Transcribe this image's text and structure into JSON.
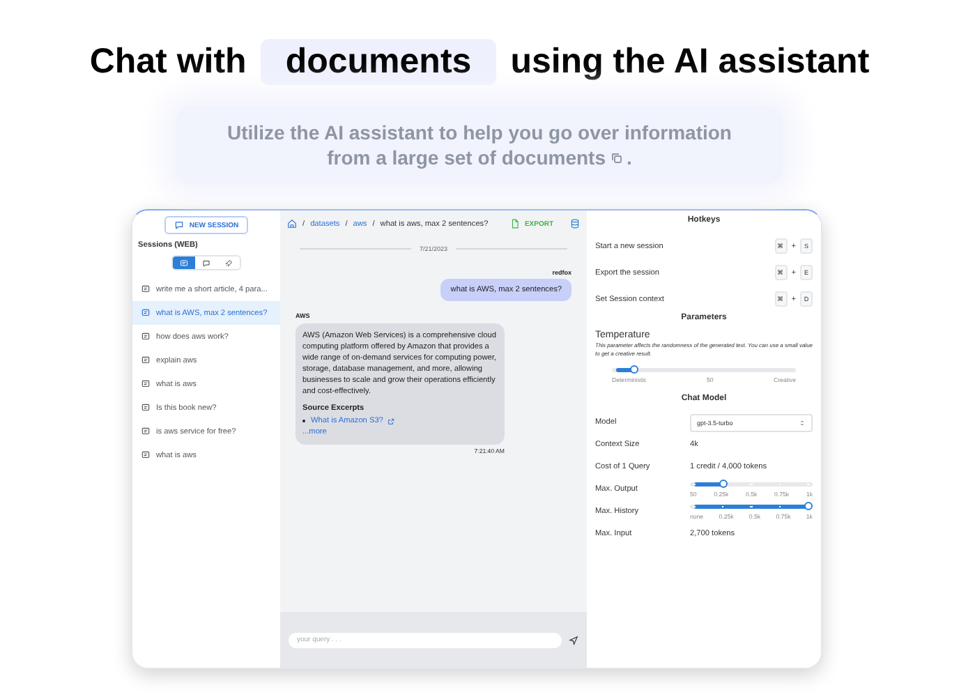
{
  "headline": {
    "before": "Chat with",
    "highlight": "documents",
    "after": "using the AI assistant"
  },
  "subtitle": {
    "lines": [
      "Utilize the AI assistant to help you go over information",
      "from a large set of documents"
    ],
    "end": "."
  },
  "sidebar": {
    "new_session": "NEW SESSION",
    "title": "Sessions (WEB)",
    "filters": [
      {
        "kind": "list",
        "selected": true
      },
      {
        "kind": "chat",
        "selected": false
      },
      {
        "kind": "rocket",
        "selected": false
      }
    ],
    "sessions": [
      {
        "label": "write me a short article, 4 para...",
        "selected": false
      },
      {
        "label": "what is AWS, max 2 sentences?",
        "selected": true
      },
      {
        "label": "how does aws work?",
        "selected": false
      },
      {
        "label": "explain aws",
        "selected": false
      },
      {
        "label": "what is aws",
        "selected": false
      },
      {
        "label": "Is this book new?",
        "selected": false
      },
      {
        "label": "is aws service for free?",
        "selected": false
      },
      {
        "label": "what is aws",
        "selected": false
      }
    ]
  },
  "chat": {
    "separator": "/",
    "breadcrumb": [
      "datasets",
      "aws"
    ],
    "current": "what is aws, max 2 sentences?",
    "export": "EXPORT",
    "date": "7/21/2023",
    "messages": [
      {
        "kind": "user",
        "author": "redfox",
        "text": "what is AWS, max 2 sentences?"
      },
      {
        "kind": "assistant",
        "author": "AWS",
        "text": "AWS (Amazon Web Services) is a comprehensive cloud computing platform offered by Amazon that provides a wide range of on-demand services for computing power, storage, database management, and more, allowing businesses to scale and grow their operations efficiently and cost-effectively.",
        "sources_title": "Source Excerpts",
        "sources": [
          "What is Amazon S3?"
        ],
        "more": "...more",
        "time": "7:21:40 AM"
      }
    ],
    "placeholder": "your query . . ."
  },
  "hotkeys": {
    "title": "Hotkeys",
    "joiner": "+",
    "items": [
      {
        "label": "Start a new session",
        "keys": [
          "⌘",
          "S"
        ]
      },
      {
        "label": "Export the session",
        "keys": [
          "⌘",
          "E"
        ]
      },
      {
        "label": "Set Session context",
        "keys": [
          "⌘",
          "D"
        ]
      }
    ]
  },
  "parameters": {
    "title": "Parameters",
    "label": "Temperature",
    "description": "This parameter affects the randomness of the generated text. You can use a small value to get a creative result.",
    "level": 0.1,
    "ticks": [
      "Deterministic",
      "50",
      "Creative"
    ]
  },
  "chat_model": {
    "title": "Chat Model",
    "rows": [
      {
        "kind": "select",
        "label": "Model",
        "value": "gpt-3.5-turbo"
      },
      {
        "kind": "text",
        "label": "Context Size",
        "value": "4k"
      },
      {
        "kind": "text",
        "label": "Cost of 1 Query",
        "value": "1 credit  /  4,000 tokens"
      },
      {
        "kind": "slider",
        "label": "Max. Output",
        "level": 0.25,
        "ticks": [
          "50",
          "0.25k",
          "0.5k",
          "0.75k",
          "1k"
        ]
      },
      {
        "kind": "slider",
        "label": "Max. History",
        "level": 1,
        "ticks": [
          "none",
          "0.25k",
          "0.5k",
          "0.75k",
          "1k"
        ]
      },
      {
        "kind": "text",
        "label": "Max. Input",
        "value": "2,700 tokens"
      }
    ]
  }
}
